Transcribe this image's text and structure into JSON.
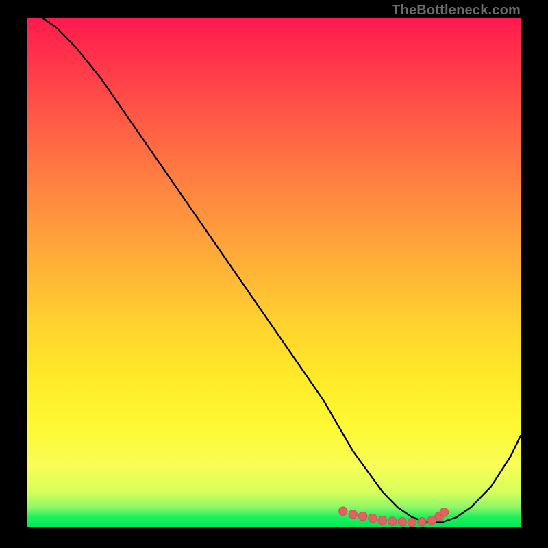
{
  "watermark": "TheBottleneck.com",
  "colors": {
    "page_bg": "#000000",
    "curve": "#000000",
    "marker_fill": "#e06262",
    "marker_stroke": "#d24f4f"
  },
  "chart_data": {
    "type": "line",
    "title": "",
    "xlabel": "",
    "ylabel": "",
    "xlim": [
      0,
      100
    ],
    "ylim": [
      0,
      100
    ],
    "grid": false,
    "legend": false,
    "series": [
      {
        "name": "bottleneck-curve",
        "x": [
          3,
          6,
          10,
          15,
          20,
          25,
          30,
          35,
          40,
          45,
          50,
          55,
          60,
          63,
          66,
          69,
          72,
          75,
          78,
          81,
          84,
          87,
          90,
          94,
          98,
          100
        ],
        "y": [
          100,
          98,
          94,
          88,
          81,
          74,
          67,
          60,
          53,
          46,
          39,
          32,
          25,
          20,
          15,
          11,
          7,
          4,
          2,
          1,
          1,
          2,
          4,
          8,
          14,
          18
        ]
      }
    ],
    "markers": {
      "name": "flat-minimum-points",
      "x": [
        64,
        66,
        68,
        70,
        72,
        74,
        76,
        78,
        80,
        82,
        83.5,
        84.5
      ],
      "y": [
        3.2,
        2.6,
        2.2,
        1.8,
        1.4,
        1.2,
        1.1,
        1.0,
        1.1,
        1.4,
        2.2,
        3.0
      ]
    }
  }
}
